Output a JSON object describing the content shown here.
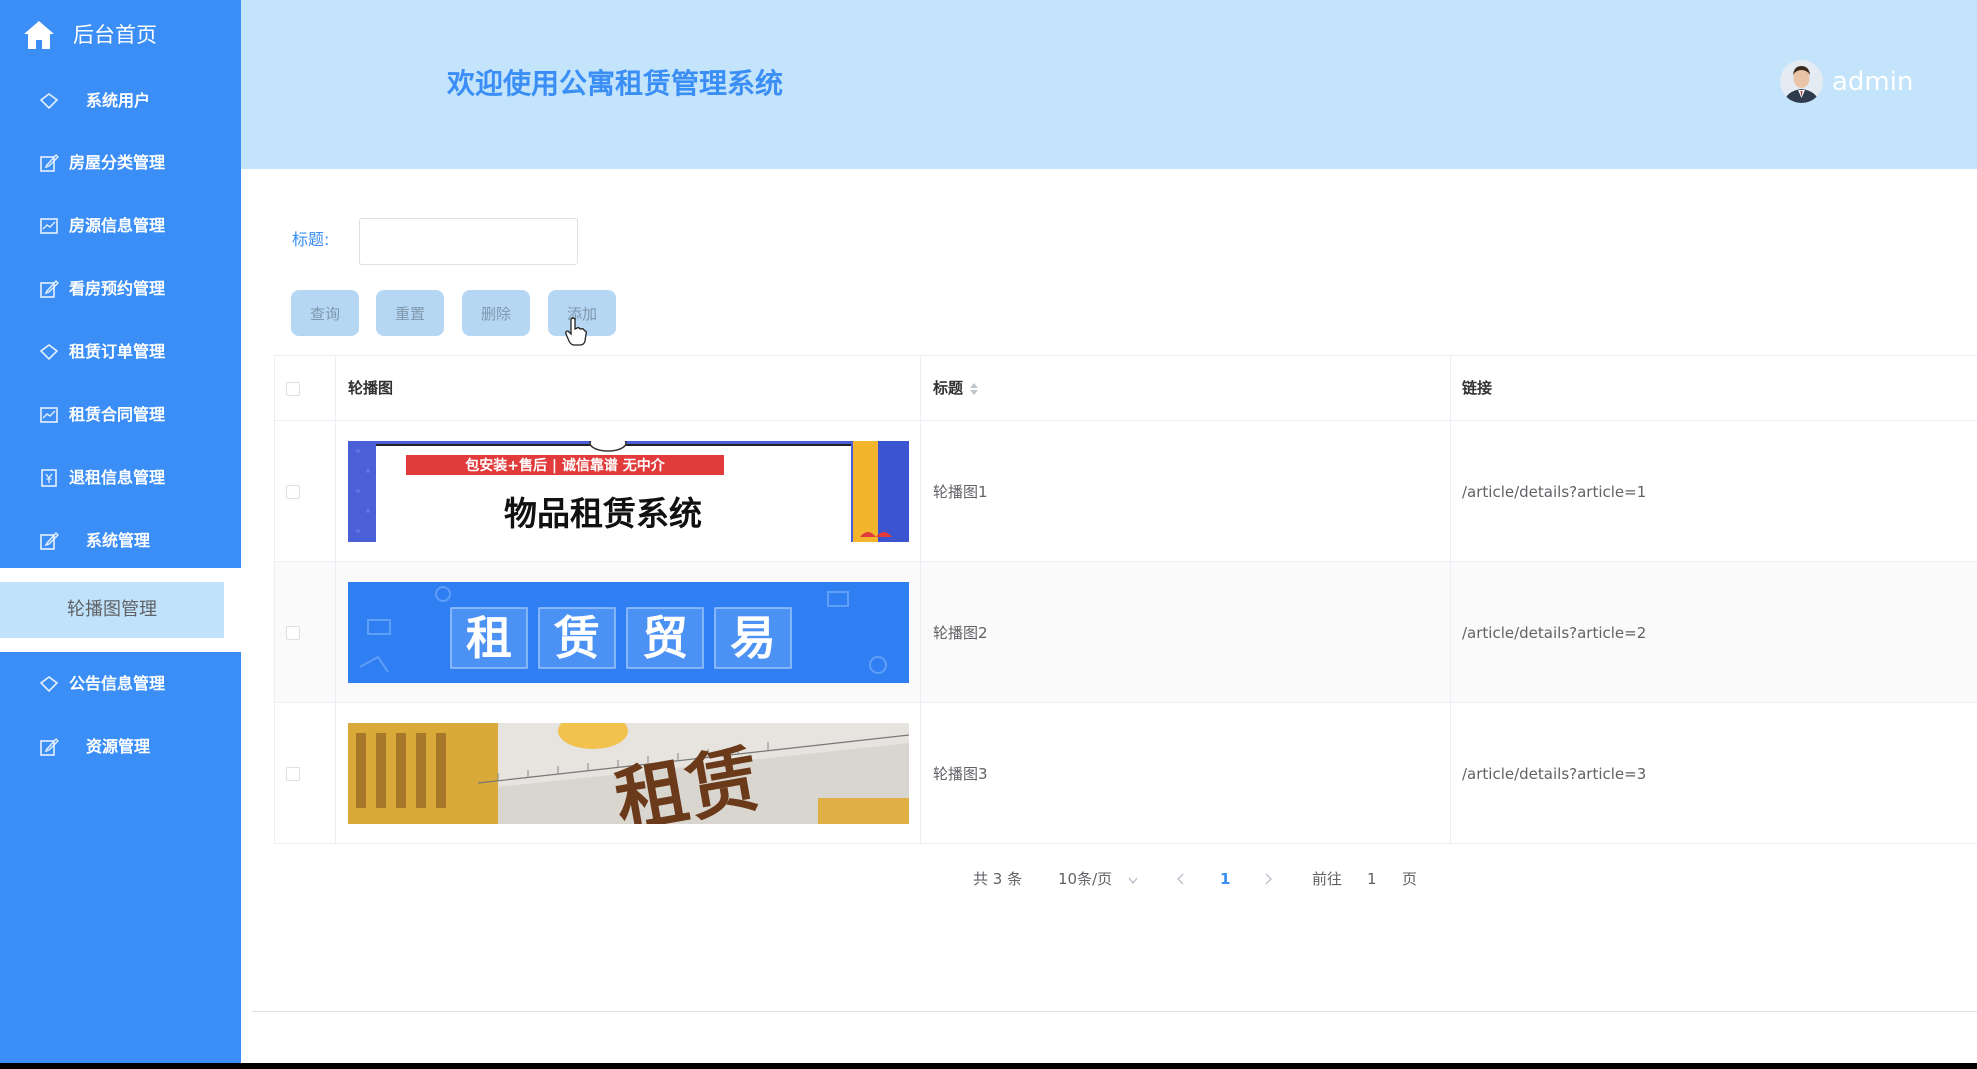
{
  "sidebar": {
    "home_label": "后台首页",
    "items": [
      {
        "label": "系统用户",
        "icon": "diamond-icon"
      },
      {
        "label": "房屋分类管理",
        "icon": "edit-icon"
      },
      {
        "label": "房源信息管理",
        "icon": "chart-icon"
      },
      {
        "label": "看房预约管理",
        "icon": "edit-icon"
      },
      {
        "label": "租赁订单管理",
        "icon": "diamond-icon"
      },
      {
        "label": "租赁合同管理",
        "icon": "chart-icon"
      },
      {
        "label": "退租信息管理",
        "icon": "yen-icon"
      },
      {
        "label": "系统管理",
        "icon": "edit-icon"
      },
      {
        "label": "公告信息管理",
        "icon": "diamond-icon"
      },
      {
        "label": "资源管理",
        "icon": "edit-icon"
      }
    ],
    "submenu_active": "轮播图管理"
  },
  "header": {
    "title": "欢迎使用公寓租赁管理系统",
    "username": "admin"
  },
  "search": {
    "label": "标题:",
    "value": ""
  },
  "buttons": {
    "query": "查询",
    "reset": "重置",
    "delete": "删除",
    "add": "添加"
  },
  "table": {
    "headers": {
      "image": "轮播图",
      "title": "标题",
      "link": "链接"
    },
    "rows": [
      {
        "title": "轮播图1",
        "link": "/article/details?article=1",
        "banner_top": "包安装+售后 | 诚信靠谱 无中介",
        "banner_main": "物品租赁系统"
      },
      {
        "title": "轮播图2",
        "link": "/article/details?article=2",
        "banner_main": "租赁贸易",
        "banner_chars": [
          "租",
          "赁",
          "贸",
          "易"
        ]
      },
      {
        "title": "轮播图3",
        "link": "/article/details?article=3",
        "banner_main": "租赁"
      }
    ]
  },
  "pagination": {
    "total": "共 3 条",
    "page_size": "10条/页",
    "current_page": "1",
    "goto_label": "前往",
    "goto_value": "1",
    "page_suffix": "页"
  },
  "colors": {
    "accent": "#3a8ef6",
    "header_bg": "#c3e4fa",
    "button_bg": "#b5d7f3"
  }
}
